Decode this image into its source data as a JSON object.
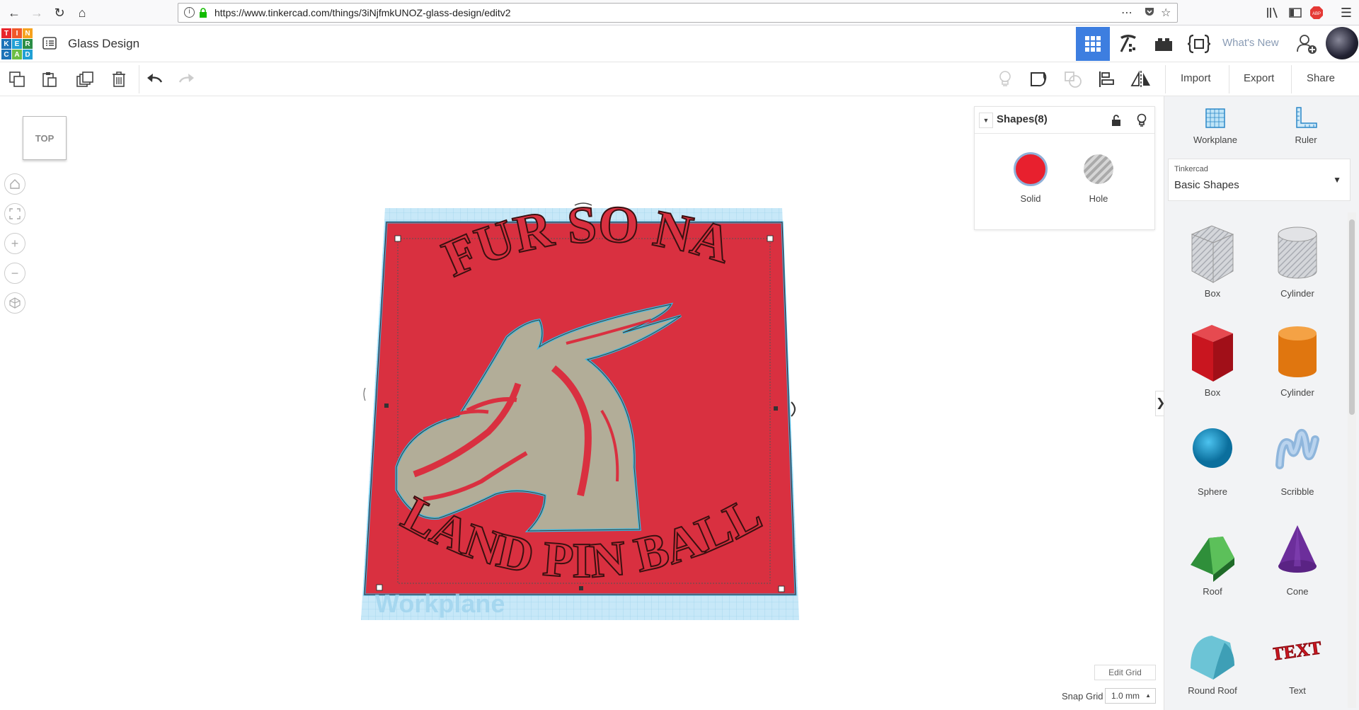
{
  "browser": {
    "url": "https://www.tinkercad.com/things/3iNjfmkUNOZ-glass-design/editv2"
  },
  "app": {
    "logo_letters": [
      "T",
      "I",
      "N",
      "K",
      "E",
      "R",
      "C",
      "A",
      "D"
    ],
    "design_title": "Glass Design",
    "whats_new": "What's New"
  },
  "toolbar": {
    "import_label": "Import",
    "export_label": "Export",
    "share_label": "Share"
  },
  "view": {
    "cube_label": "TOP",
    "workplane_watermark": "Workplane"
  },
  "design": {
    "top_text": "FUR SO NA",
    "bottom_text": "LAND PIN BALL"
  },
  "inspector": {
    "title": "Shapes(8)",
    "solid_label": "Solid",
    "hole_label": "Hole",
    "solid_color": "#e8202e"
  },
  "right_panel": {
    "workplane_label": "Workplane",
    "ruler_label": "Ruler",
    "library_small": "Tinkercad",
    "library_name": "Basic Shapes",
    "shapes": [
      {
        "label": "Box",
        "icon": "box-hole-icon"
      },
      {
        "label": "Cylinder",
        "icon": "cylinder-hole-icon"
      },
      {
        "label": "Box",
        "icon": "box-red-icon"
      },
      {
        "label": "Cylinder",
        "icon": "cylinder-orange-icon"
      },
      {
        "label": "Sphere",
        "icon": "sphere-icon"
      },
      {
        "label": "Scribble",
        "icon": "scribble-icon"
      },
      {
        "label": "Roof",
        "icon": "roof-icon"
      },
      {
        "label": "Cone",
        "icon": "cone-icon"
      },
      {
        "label": "Round Roof",
        "icon": "round-roof-icon"
      },
      {
        "label": "Text",
        "icon": "text-icon"
      }
    ]
  },
  "grid": {
    "edit_grid_label": "Edit Grid",
    "snap_label": "Snap Grid",
    "snap_value": "1.0 mm"
  },
  "colors": {
    "accent": "#3d7ee0",
    "plate_red": "#d93040",
    "workplane_blue": "#bfe4f7",
    "dragon_gray": "#b2ad98",
    "outline_cyan": "#39b9e6"
  }
}
